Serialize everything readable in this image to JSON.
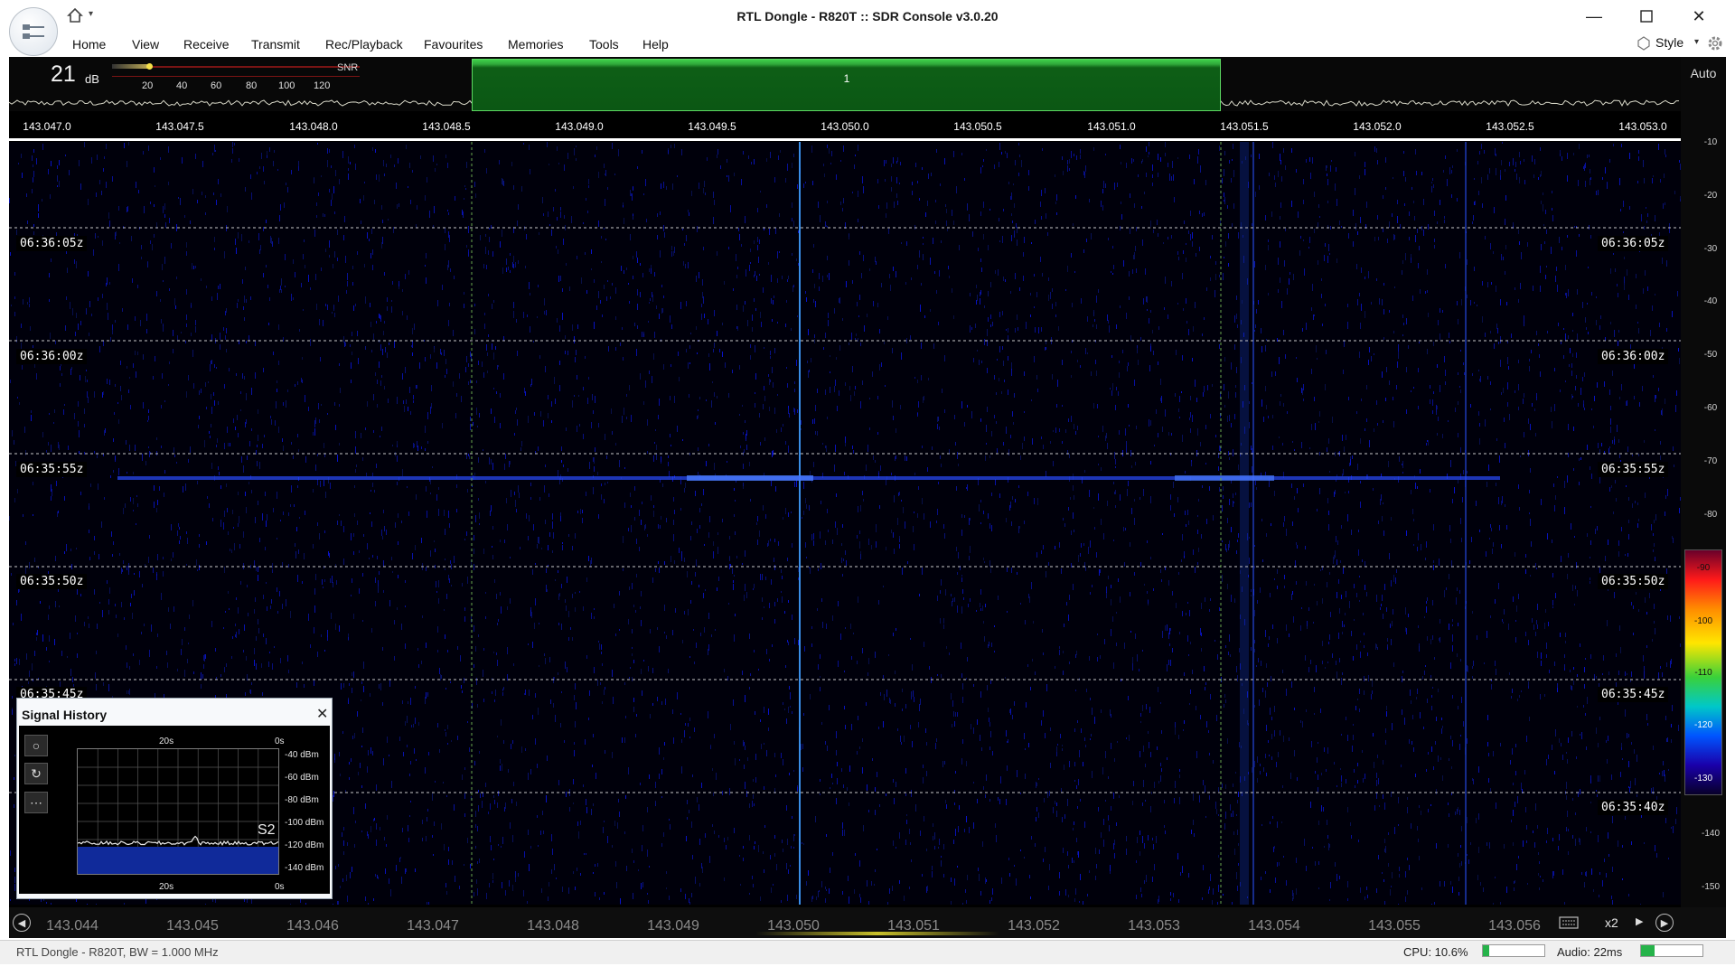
{
  "window": {
    "title": "RTL Dongle - R820T :: SDR Console v3.0.20",
    "controls": [
      "minimize",
      "maximize",
      "close"
    ]
  },
  "menu": {
    "items": [
      "Home",
      "View",
      "Receive",
      "Transmit",
      "Rec/Playback",
      "Favourites",
      "Memories",
      "Tools",
      "Help"
    ],
    "style_label": "Style"
  },
  "snr": {
    "value": "21",
    "unit": "dB",
    "label": "SNR",
    "scale": [
      "20",
      "40",
      "60",
      "80",
      "100",
      "120"
    ]
  },
  "spectrum": {
    "auto_label": "Auto",
    "band_label": "1",
    "band_color": "#1f8f2a",
    "freq_ticks": [
      "143.047.0",
      "143.047.5",
      "143.048.0",
      "143.048.5",
      "143.049.0",
      "143.049.5",
      "143.050.0",
      "143.050.5",
      "143.051.0",
      "143.051.5",
      "143.052.0",
      "143.052.5",
      "143.053.0"
    ]
  },
  "waterfall": {
    "time_rows": [
      "06:36:05z",
      "06:36:00z",
      "06:35:55z",
      "06:35:50z",
      "06:35:45z",
      "06:35:40z"
    ],
    "db_scale": [
      "-10",
      "-20",
      "-30",
      "-40",
      "-50",
      "-60",
      "-70",
      "-80",
      "-140",
      "-150"
    ],
    "colorbar_labels": [
      "-90",
      "-100",
      "-110",
      "-120",
      "-130"
    ]
  },
  "signal_history": {
    "title": "Signal History",
    "time_labels": [
      "20s",
      "0s"
    ],
    "dbm_labels": [
      "-40 dBm",
      "-60 dBm",
      "-80 dBm",
      "-100 dBm",
      "-120 dBm",
      "-140 dBm"
    ],
    "s_meter": "S2",
    "buttons": [
      "record",
      "reset",
      "more"
    ]
  },
  "bottom_ruler": {
    "freqs": [
      "143.044",
      "143.045",
      "143.046",
      "143.047",
      "143.048",
      "143.049",
      "143.050",
      "143.051",
      "143.052",
      "143.053",
      "143.054",
      "143.055",
      "143.056"
    ],
    "zoom": "x2"
  },
  "status": {
    "left": "RTL Dongle - R820T, BW = 1.000 MHz",
    "cpu": "CPU: 10.6%",
    "cpu_level": 0.106,
    "audio": "Audio: 22ms",
    "audio_level": 0.22
  }
}
